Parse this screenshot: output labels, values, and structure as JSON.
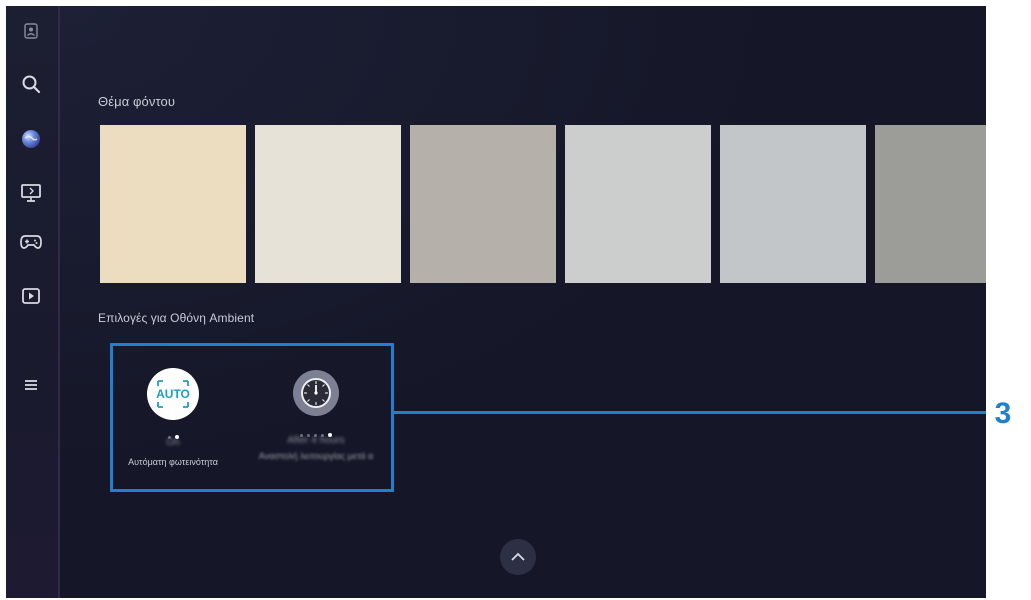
{
  "sidebar": {
    "items": [
      {
        "name": "profile",
        "icon": "profile-icon"
      },
      {
        "name": "search",
        "icon": "search-icon"
      },
      {
        "name": "ambient",
        "icon": "ambient-globe-icon"
      },
      {
        "name": "media",
        "icon": "monitor-icon"
      },
      {
        "name": "game",
        "icon": "gamepad-icon"
      },
      {
        "name": "play",
        "icon": "play-icon"
      },
      {
        "name": "menu",
        "icon": "hamburger-menu-icon"
      }
    ]
  },
  "background_theme": {
    "title": "Θέμα φόντου",
    "swatches": [
      "#ecdcc0",
      "#e6e2d8",
      "#b5b1aa",
      "#cbcecd",
      "#c2c6c9",
      "#9c9c98"
    ]
  },
  "ambient_options": {
    "title": "Επιλογές για Οθόνη Ambient",
    "items": [
      {
        "icon": "auto-brightness-icon",
        "icon_text": "AUTO",
        "value": "On",
        "label": "Αυτόματη φωτεινότητα"
      },
      {
        "icon": "timer-dial-icon",
        "value": "After 4 hours",
        "label": "Αναστολή λειτουργίας μετά α"
      }
    ]
  },
  "callout": {
    "number": "3"
  },
  "colors": {
    "accent": "#1f7fd1",
    "screen_bg": "#151728"
  }
}
